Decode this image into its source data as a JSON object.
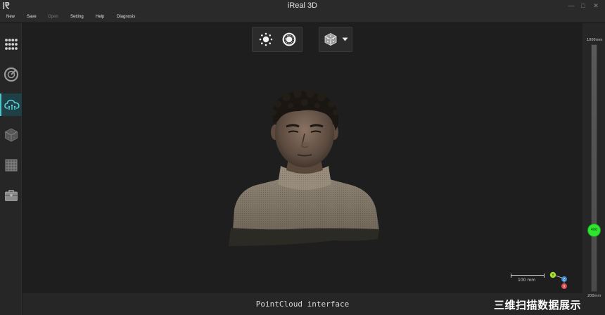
{
  "window": {
    "logo_text": "iR",
    "title": "iReal 3D",
    "minimize_glyph": "—",
    "maximize_glyph": "□",
    "close_glyph": "✕"
  },
  "menu": [
    {
      "label": "New",
      "enabled": true
    },
    {
      "label": "Save",
      "enabled": true
    },
    {
      "label": "Open",
      "enabled": false
    },
    {
      "label": "Setting",
      "enabled": true
    },
    {
      "label": "Help",
      "enabled": true
    },
    {
      "label": "Diagnosis",
      "enabled": true
    }
  ],
  "left_toolbar": [
    {
      "icon": "dot-grid-icon",
      "active": false
    },
    {
      "icon": "scan-target-icon",
      "active": false
    },
    {
      "icon": "cloud-upload-icon",
      "active": true
    },
    {
      "icon": "mesh-cube-icon",
      "active": false
    },
    {
      "icon": "texture-grid-icon",
      "active": false
    },
    {
      "icon": "toolbox-icon",
      "active": false
    }
  ],
  "view_toolbar": {
    "left_group": [
      "brightness-dots-icon",
      "brightness-ring-icon"
    ],
    "right_group": [
      "render-mode-cube-icon",
      "dropdown-arrow-icon"
    ]
  },
  "scale": {
    "label": "100 mm"
  },
  "axis": {
    "y": "Y",
    "z": "Z",
    "x": "X"
  },
  "status": {
    "text": "PointCloud interface",
    "watermark": "三维扫描数据展示"
  },
  "depth_slider": {
    "max_label": "1000mm",
    "min_label": "200mm",
    "value_label": "400",
    "value": 400,
    "min": 200,
    "max": 1000,
    "accent": "#2ee62e"
  },
  "colors": {
    "background": "#1e1e1e",
    "active_tool": "#4fc3c8"
  }
}
